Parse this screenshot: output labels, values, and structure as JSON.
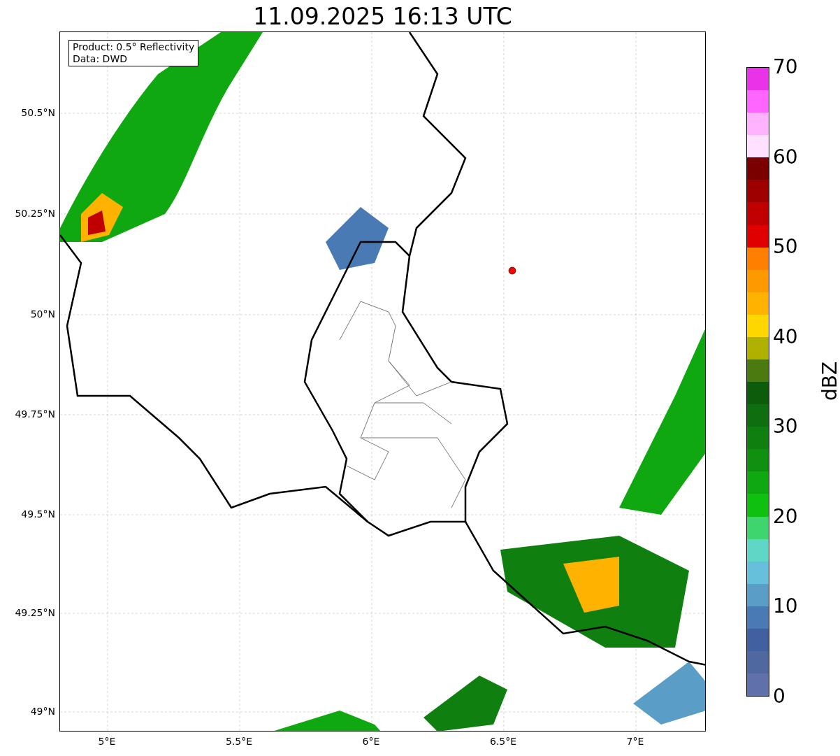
{
  "title": "11.09.2025 16:13 UTC",
  "info_box": [
    "Product: 0.5° Reflectivity",
    "Data: DWD"
  ],
  "x_ticks": [
    "5°E",
    "5.5°E",
    "6°E",
    "6.5°E",
    "7°E"
  ],
  "y_ticks": [
    "50.5°N",
    "50.25°N",
    "50°N",
    "49.75°N",
    "49.5°N",
    "49.25°N",
    "49°N"
  ],
  "colorbar": {
    "label": "dBZ",
    "ticks": [
      "70",
      "60",
      "50",
      "40",
      "30",
      "20",
      "10",
      "0"
    ],
    "segments": [
      {
        "color": "#e933e9"
      },
      {
        "color": "#ff66ff"
      },
      {
        "color": "#ffb3ff"
      },
      {
        "color": "#ffe0ff"
      },
      {
        "color": "#7a0000"
      },
      {
        "color": "#9e0000"
      },
      {
        "color": "#c00000"
      },
      {
        "color": "#e00000"
      },
      {
        "color": "#ff7f00"
      },
      {
        "color": "#ff9900"
      },
      {
        "color": "#ffb300"
      },
      {
        "color": "#ffd700"
      },
      {
        "color": "#b0b000"
      },
      {
        "color": "#4a7a10"
      },
      {
        "color": "#0c5c0c"
      },
      {
        "color": "#0f6e0f"
      },
      {
        "color": "#0f800f"
      },
      {
        "color": "#109010"
      },
      {
        "color": "#10a810"
      },
      {
        "color": "#10c010"
      },
      {
        "color": "#3ed46e"
      },
      {
        "color": "#5fd6c6"
      },
      {
        "color": "#66c0dc"
      },
      {
        "color": "#5a9ec8"
      },
      {
        "color": "#4a7ab4"
      },
      {
        "color": "#4060a0"
      },
      {
        "color": "#5068a0"
      },
      {
        "color": "#6070a8"
      }
    ]
  }
}
